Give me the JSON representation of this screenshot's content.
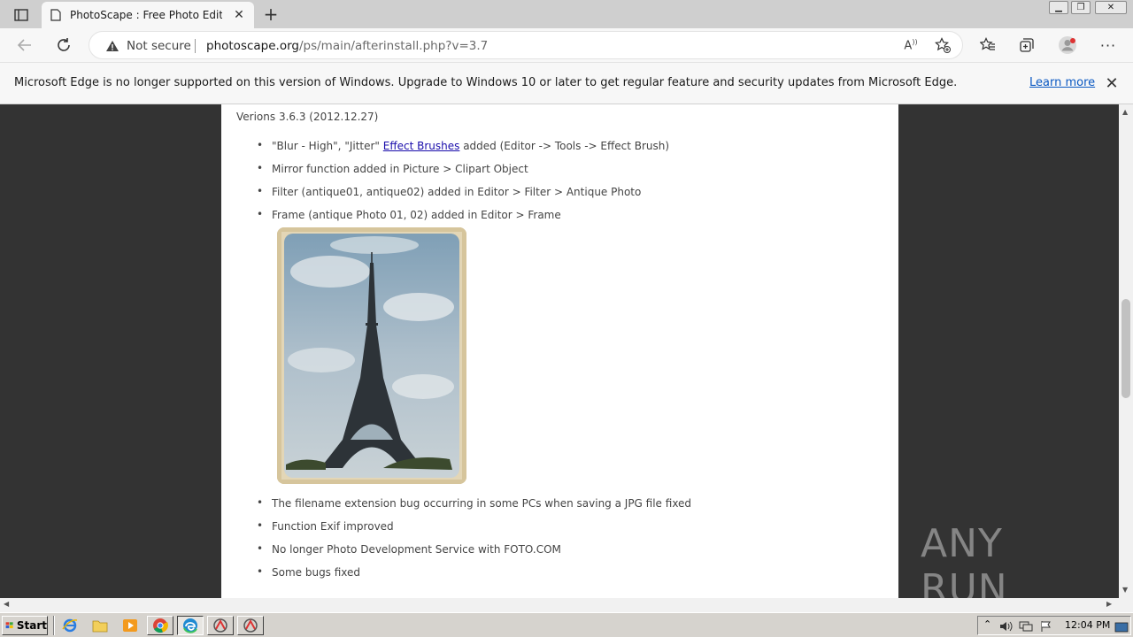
{
  "browser": {
    "tab_title": "PhotoScape : Free Photo Editing",
    "address": {
      "security_label": "Not secure",
      "host": "photoscape.org",
      "path": "/ps/main/afterinstall.php?v=3.7"
    }
  },
  "infobar": {
    "message": "Microsoft Edge is no longer supported on this version of Windows. Upgrade to Windows 10 or later to get regular feature and security updates from Microsoft Edge.",
    "link": "Learn more"
  },
  "page": {
    "version_title": "Verions 3.6.3 (2012.12.27)",
    "items_before": [
      {
        "prefix": "\"Blur - High\", \"Jitter\" ",
        "link": "Effect Brushes",
        "suffix": " added (Editor -> Tools -> Effect Brush)"
      },
      {
        "text": "Mirror function added in Picture > Clipart Object"
      },
      {
        "text": "Filter (antique01, antique02) added in Editor > Filter > Antique Photo"
      },
      {
        "text": "Frame (antique Photo 01, 02) added in Editor > Frame"
      }
    ],
    "items_after": [
      "The filename extension bug occurring in some PCs when saving a JPG file fixed",
      "Function Exif improved",
      "No longer Photo Development Service with FOTO.COM",
      "Some bugs fixed"
    ]
  },
  "watermark": "ANY RUN",
  "taskbar": {
    "start_label": "Start",
    "clock": "12:04 PM"
  },
  "icons": {
    "tab_actions": "tab-actions-icon",
    "page": "page-icon",
    "back": "back-arrow-icon",
    "refresh": "refresh-icon",
    "warning": "warning-icon",
    "read_aloud": "read-aloud-icon",
    "add_favorite": "add-favorite-icon",
    "favorites": "favorites-icon",
    "collections": "collections-icon",
    "profile": "profile-icon",
    "more": "more-icon"
  },
  "colors": {
    "link": "#0a58c2",
    "page_link": "#1a0dab",
    "background": "#333333"
  }
}
